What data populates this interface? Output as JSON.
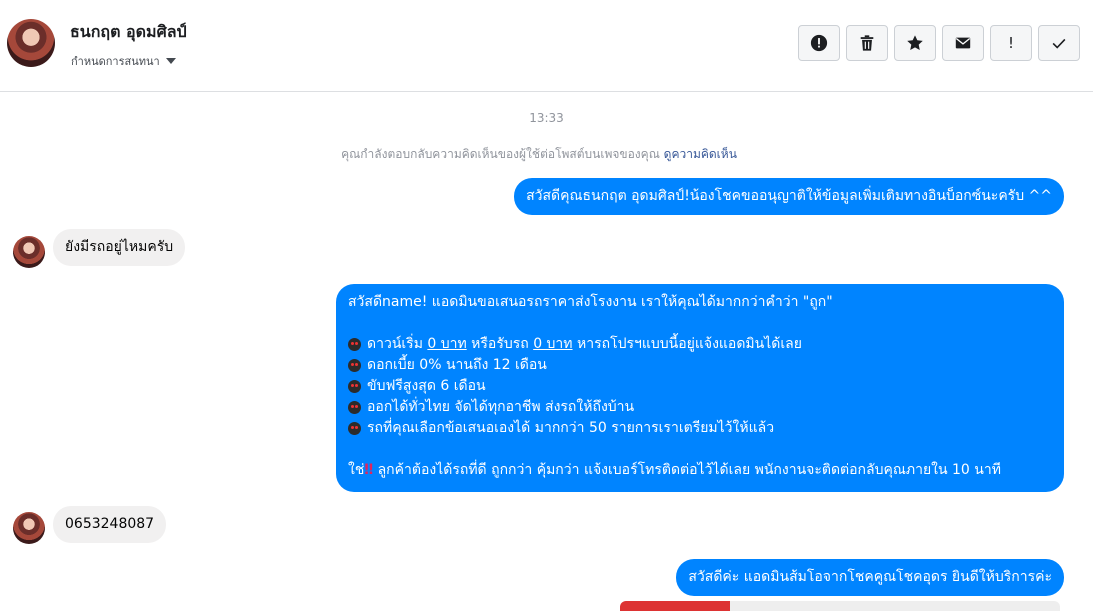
{
  "header": {
    "contact_name": "ธนกฤต อุดมศิลป์",
    "assign_label": "กำหนดการสนทนา",
    "toolbar": [
      {
        "name": "alert-button",
        "icon": "alert-circle-icon"
      },
      {
        "name": "delete-button",
        "icon": "trash-icon"
      },
      {
        "name": "star-button",
        "icon": "star-icon"
      },
      {
        "name": "mail-button",
        "icon": "envelope-icon"
      },
      {
        "name": "important-button",
        "icon": "exclamation-icon",
        "label": "!"
      },
      {
        "name": "done-button",
        "icon": "check-icon"
      }
    ]
  },
  "conversation": {
    "timestamp": "13:33",
    "notice_text": "คุณกำลังตอบกลับความคิดเห็นของผู้ใช้ต่อโพสต์บนเพจของคุณ",
    "notice_link": "ดูความคิดเห็น",
    "msg1": "สวัสดีคุณธนกฤต อุดมศิลป์!น้องโชคขออนุญาติให้ข้อมูลเพิ่มเติมทางอินบ็อกซ์นะครับ ^^",
    "msg2": "ยังมีรถอยู่ไหมครับ",
    "msg3": {
      "l1": "สวัสดีname! แอดมินขอเสนอรถราคาส่งโรงงาน เราให้คุณได้มากกว่าคำว่า \"ถูก\"",
      "l2a": "ดาวน์เริ่ม",
      "l2b": "0 บาท",
      "l2c": "หรือรับรถ",
      "l2d": "0 บาท",
      "l2e": "หารถโปรฯแบบนี้อยู่แจ้งแอดมินได้เลย",
      "l3": "ดอกเบี้ย 0% นานถึง 12 เดือน",
      "l4": "ขับฟรีสูงสุด 6 เดือน",
      "l5": "ออกได้ทั่วไทย จัดได้ทุกอาชีพ ส่งรถให้ถึงบ้าน",
      "l6": "รถที่คุณเลือกข้อเสนอเองได้ มากกว่า 50 รายการเราเตรียมไว้ให้แล้ว",
      "l7a": "ใช่",
      "l7b": "‼",
      "l7c": "ลูกค้าต้องได้รถที่ดี ถูกกว่า คุ้มกว่า แจ้งเบอร์โทรติดต่อไว้ได้เลย พนักงานจะติดต่อกลับคุณภายใน 10 นาที"
    },
    "msg4": "0653248087",
    "msg5": "สวัสดีค่ะ แอดมินส้มโอจากโชคคูณโชคอุดร ยินดีให้บริการค่ะ"
  },
  "colors": {
    "outgoing": "#0084ff",
    "incoming": "#f1f0f0",
    "link": "#385898"
  }
}
